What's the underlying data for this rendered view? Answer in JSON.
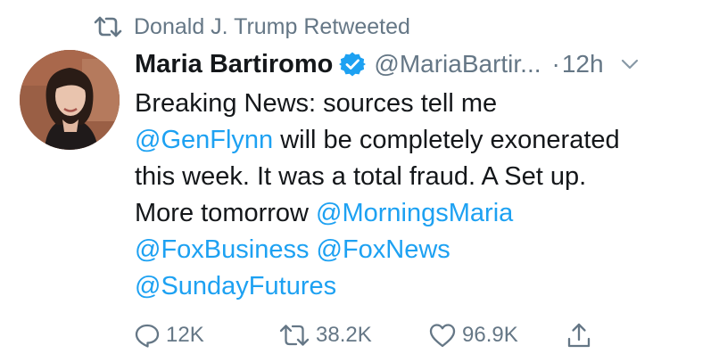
{
  "retweet_context": {
    "text": "Donald J. Trump Retweeted",
    "icon": "retweet-icon"
  },
  "author": {
    "display_name": "Maria Bartiromo",
    "verified": true,
    "handle": "@MariaBartir...",
    "separator": "·",
    "time": "12h",
    "avatar_icon": "avatar-photo"
  },
  "tweet": {
    "line1": "Breaking News: sources tell me",
    "mention_genflynn": "@GenFlynn",
    "line2_rest": " will be completely exonerated",
    "line3": "this week.  It was a total fraud.  A Set up.",
    "line4_prefix": "More tomorrow ",
    "mention_morningsmaria": "@MorningsMaria",
    "mention_foxbusiness": "@FoxBusiness",
    "line5_space": " ",
    "mention_foxnews": "@FoxNews",
    "mention_sundayfutures": "@SundayFutures"
  },
  "actions": {
    "reply_count": "12K",
    "retweet_count": "38.2K",
    "like_count": "96.9K"
  },
  "colors": {
    "link": "#1da1f2",
    "muted": "#657786",
    "text": "#14171a",
    "verified": "#1da1f2"
  }
}
